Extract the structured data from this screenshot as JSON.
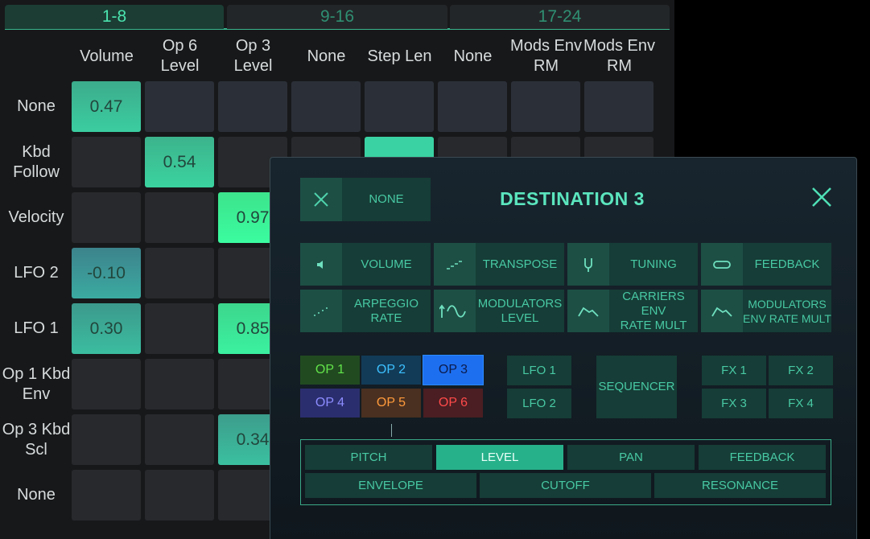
{
  "tabs": [
    {
      "label": "1-8",
      "active": true
    },
    {
      "label": "9-16",
      "active": false
    },
    {
      "label": "17-24",
      "active": false
    }
  ],
  "columns": [
    "Volume",
    "Op 6\nLevel",
    "Op 3\nLevel",
    "None",
    "Step Len",
    "None",
    "Mods Env\nRM",
    "Mods Env\nRM"
  ],
  "rows": [
    {
      "label": "None",
      "cells": [
        "0.47",
        "",
        "",
        "",
        "",
        "",
        "",
        ""
      ]
    },
    {
      "label": "Kbd\nFollow",
      "cells": [
        "",
        "0.54",
        "",
        "",
        "",
        "",
        "",
        ""
      ]
    },
    {
      "label": "Velocity",
      "cells": [
        "",
        "",
        "0.97",
        "",
        "",
        "",
        "",
        ""
      ]
    },
    {
      "label": "LFO 2",
      "cells": [
        "-0.10",
        "",
        "",
        "",
        "",
        "",
        "",
        ""
      ]
    },
    {
      "label": "LFO 1",
      "cells": [
        "0.30",
        "",
        "0.85",
        "",
        "",
        "",
        "",
        ""
      ]
    },
    {
      "label": "Op 1 Kbd\nEnv",
      "cells": [
        "",
        "",
        "",
        "",
        "",
        "",
        "",
        ""
      ]
    },
    {
      "label": "Op 3 Kbd\nScl",
      "cells": [
        "",
        "",
        "0.34",
        "",
        "",
        "",
        "",
        ""
      ]
    },
    {
      "label": "None",
      "cells": [
        "",
        "",
        "",
        "",
        "",
        "",
        "",
        ""
      ]
    }
  ],
  "dialog": {
    "none_label": "NONE",
    "title": "DESTINATION 3",
    "destinations": [
      {
        "label": "VOLUME",
        "icon": "speaker-icon"
      },
      {
        "label": "TRANSPOSE",
        "icon": "stairs-icon"
      },
      {
        "label": "TUNING",
        "icon": "tuning-fork-icon"
      },
      {
        "label": "FEEDBACK",
        "icon": "loop-icon"
      },
      {
        "label": "ARPEGGIO\nRATE",
        "icon": "arpeggio-icon"
      },
      {
        "label": "MODULATORS\nLEVEL",
        "icon": "sine-icon"
      },
      {
        "label": "CARRIERS ENV\nRATE MULT",
        "icon": "envelope-icon"
      },
      {
        "label": "MODULATORS\nENV RATE MULT",
        "icon": "envelope-icon"
      }
    ],
    "operators": [
      {
        "label": "OP 1",
        "color": "#62e34a",
        "bg": "#214a20"
      },
      {
        "label": "OP 2",
        "color": "#3cc0ff",
        "bg": "#123b57"
      },
      {
        "label": "OP 3",
        "color": "#0b1b4a",
        "bg": "#1e6ff0"
      },
      {
        "label": "OP 4",
        "color": "#8c8cff",
        "bg": "#2b2e6e"
      },
      {
        "label": "OP 5",
        "color": "#ff9a3c",
        "bg": "#4a3020"
      },
      {
        "label": "OP 6",
        "color": "#ff4a4a",
        "bg": "#4a1e22"
      }
    ],
    "lfos": [
      "LFO 1",
      "LFO 2"
    ],
    "sequencer": "SEQUENCER",
    "fx": [
      "FX 1",
      "FX 2",
      "FX 3",
      "FX 4"
    ],
    "params_row1": [
      {
        "label": "PITCH",
        "selected": false
      },
      {
        "label": "LEVEL",
        "selected": true
      },
      {
        "label": "PAN",
        "selected": false
      },
      {
        "label": "FEEDBACK",
        "selected": false
      }
    ],
    "params_row2": [
      "ENVELOPE",
      "CUTOFF",
      "RESONANCE"
    ]
  }
}
